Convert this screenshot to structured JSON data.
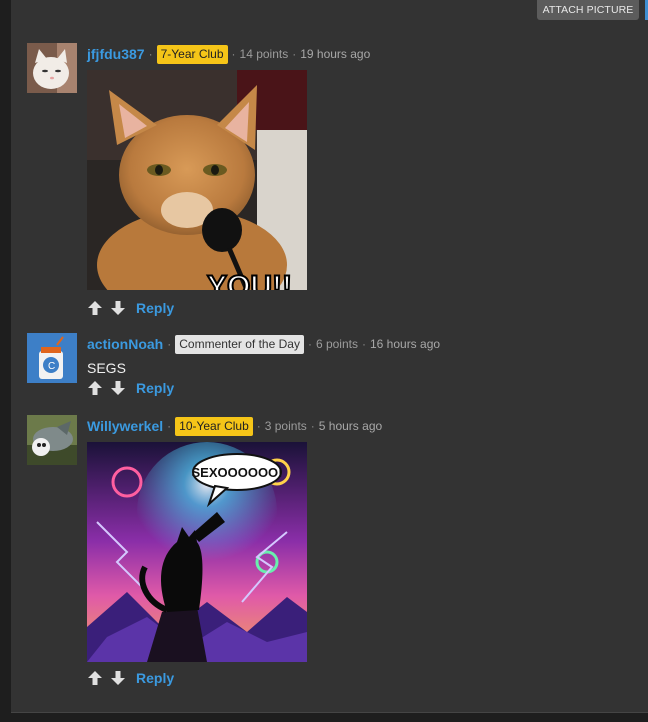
{
  "toolbar": {
    "attach_label": "ATTACH PICTURE"
  },
  "comments": [
    {
      "username": "jfjfdu387",
      "badge": "7-Year Club",
      "points": "14 points",
      "time": "19 hours ago",
      "image_caption": "YOU!!",
      "reply_label": "Reply"
    },
    {
      "username": "actionNoah",
      "badge": "Commenter of the Day",
      "points": "6 points",
      "time": "16 hours ago",
      "body": "SEGS",
      "reply_label": "Reply"
    },
    {
      "username": "Willywerkel",
      "badge": "10-Year Club",
      "points": "3 points",
      "time": "5 hours ago",
      "image_caption": "SEXOOOOOO!",
      "reply_label": "Reply"
    }
  ],
  "colors": {
    "link": "#3b9ae0",
    "gold_badge": "#f5c518",
    "grey_badge": "#e4e4e4",
    "panel": "#333333"
  },
  "icons": [
    "upvote-icon",
    "downvote-icon"
  ]
}
